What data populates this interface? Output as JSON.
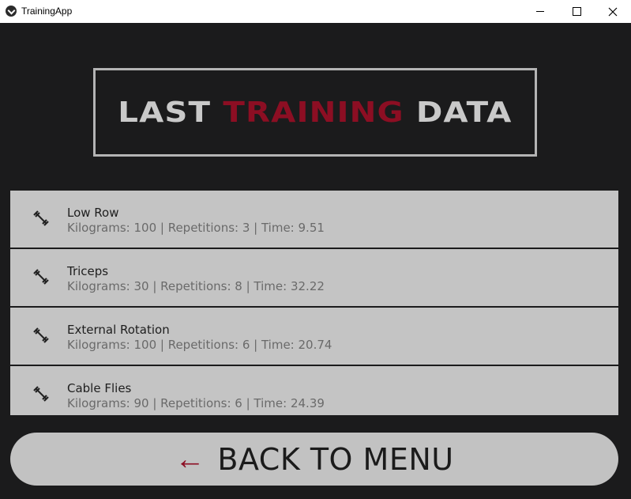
{
  "window": {
    "title": "TrainingApp",
    "icon": "app-logo-icon",
    "controls": [
      "minimize-icon",
      "maximize-icon",
      "close-icon"
    ]
  },
  "banner": {
    "word1": "LAST",
    "word2": "TRAINING",
    "word3": "DATA",
    "accent_color": "#8c0e23",
    "text_color": "#c9c9c9"
  },
  "exercises": [
    {
      "name": "Low Row",
      "detail": "Kilograms: 100 | Repetitions: 3 | Time: 9.51",
      "icon": "dumbbell-icon"
    },
    {
      "name": "Triceps",
      "detail": "Kilograms: 30 | Repetitions: 8 | Time: 32.22",
      "icon": "dumbbell-icon"
    },
    {
      "name": "External Rotation",
      "detail": "Kilograms: 100 | Repetitions: 6 | Time: 20.74",
      "icon": "dumbbell-icon"
    },
    {
      "name": "Cable Flies",
      "detail": "Kilograms: 90 | Repetitions: 6 | Time: 24.39",
      "icon": "dumbbell-icon"
    }
  ],
  "back_button": {
    "arrow": "←",
    "label": "BACK TO MENU"
  },
  "colors": {
    "background": "#1b1b1c",
    "card": "#c4c4c4"
  }
}
